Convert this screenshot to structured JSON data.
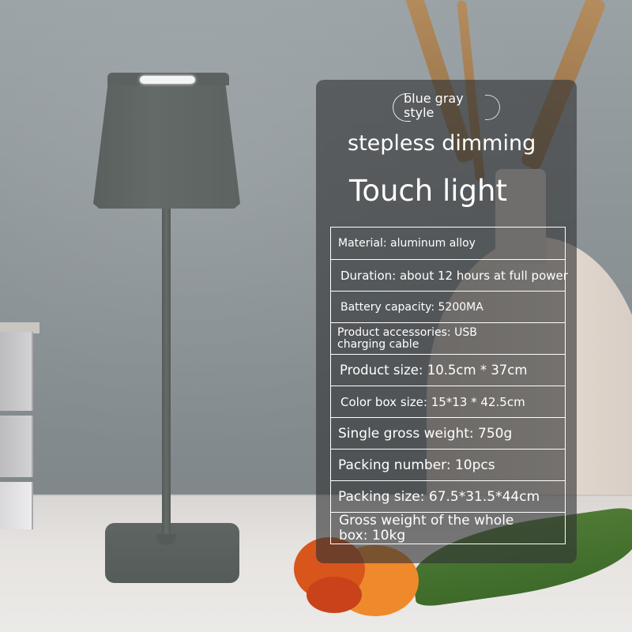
{
  "product": {
    "color_badge": "blue gray style",
    "feature_line": "stepless dimming",
    "title": "Touch light"
  },
  "specs": [
    "Material: aluminum alloy",
    "Duration: about 12 hours at full power",
    "Battery capacity: 5200MA",
    "Product accessories: USB charging cable",
    "Product size: 10.5cm * 37cm",
    "Color box size: 15*13 * 42.5cm",
    "Single gross weight: 750g",
    "Packing number: 10pcs",
    "Packing size: 67.5*31.5*44cm",
    "Gross weight of the whole box: 10kg"
  ],
  "colors": {
    "panel_overlay": "#303234",
    "text": "#ffffff",
    "lamp_body": "#5c6260"
  }
}
